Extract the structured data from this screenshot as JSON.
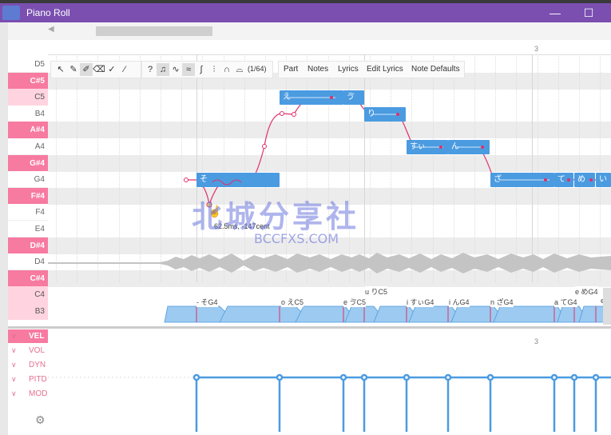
{
  "window": {
    "title": "Piano Roll",
    "minimize": "—",
    "maximize": "☐"
  },
  "ruler": {
    "bar": "3"
  },
  "keys": [
    {
      "label": "D5",
      "kind": "white"
    },
    {
      "label": "C#5",
      "kind": "black"
    },
    {
      "label": "C5",
      "kind": "light"
    },
    {
      "label": "B4",
      "kind": "white"
    },
    {
      "label": "A#4",
      "kind": "black"
    },
    {
      "label": "A4",
      "kind": "white"
    },
    {
      "label": "G#4",
      "kind": "black"
    },
    {
      "label": "G4",
      "kind": "white"
    },
    {
      "label": "F#4",
      "kind": "black"
    },
    {
      "label": "F4",
      "kind": "white"
    },
    {
      "label": "E4",
      "kind": "white"
    },
    {
      "label": "D#4",
      "kind": "black"
    },
    {
      "label": "D4",
      "kind": "white"
    },
    {
      "label": "C#4",
      "kind": "black"
    },
    {
      "label": "C4",
      "kind": "light"
    },
    {
      "label": "B3",
      "kind": "light"
    }
  ],
  "toolbar": {
    "snap": "(1/64)",
    "question": "?"
  },
  "menu": {
    "part": "Part",
    "notes": "Notes",
    "lyrics": "Lyrics",
    "edit_lyrics": "Edit Lyrics",
    "note_defaults": "Note Defaults"
  },
  "notes": [
    {
      "lyric": "そ"
    },
    {
      "lyric": "え"
    },
    {
      "lyric": "ゔ"
    },
    {
      "lyric": "り"
    },
    {
      "lyric": "すぃ"
    },
    {
      "lyric": "ん"
    },
    {
      "lyric": "ざ"
    },
    {
      "lyric": "て"
    },
    {
      "lyric": "め"
    },
    {
      "lyric": "い"
    }
  ],
  "tooltip": "62.5ms, -147cent",
  "phonemes": [
    {
      "text": "- そG4"
    },
    {
      "text": "o えC5"
    },
    {
      "text": "e ゔC5"
    },
    {
      "text": "u りC5"
    },
    {
      "text": "i すぃG4"
    },
    {
      "text": "i んG4"
    },
    {
      "text": "n ざG4"
    },
    {
      "text": "a てG4"
    },
    {
      "text": "e めG4"
    },
    {
      "text": "e l"
    }
  ],
  "expressions": [
    {
      "label": "VEL",
      "selected": true
    },
    {
      "label": "VOL",
      "selected": false
    },
    {
      "label": "DYN",
      "selected": false
    },
    {
      "label": "PITD",
      "selected": false
    },
    {
      "label": "MOD",
      "selected": false
    }
  ],
  "watermark": {
    "main": "北城分享社",
    "sub": "BCCFXS.COM"
  },
  "colors": {
    "titlebar": "#7a4fb0",
    "note": "#4b9be0",
    "accent": "#f77aa0",
    "pitch": "#e0306a"
  }
}
